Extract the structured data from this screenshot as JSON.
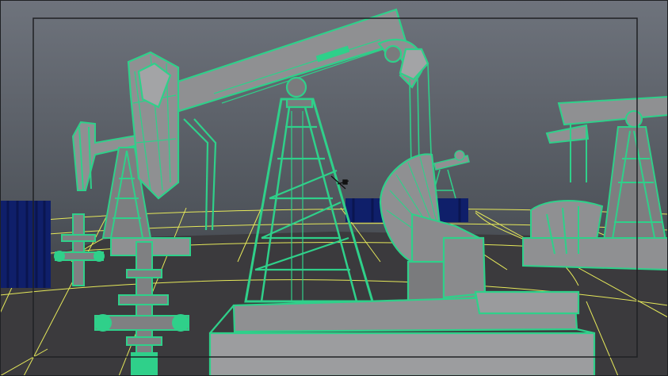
{
  "viewport": {
    "background_top": "#6e737c",
    "background_bottom": "#2e3034",
    "ground_color": "#3b3a3d",
    "grid_color": "#e5e85a",
    "wire_color": "#2fd08a",
    "mesh_color": "#8f9092",
    "frame_color": "#1f2124",
    "tank_color": "#0f1f6a",
    "manipulator_color": "#111111"
  },
  "scene": {
    "objects": [
      "pumpjack-main",
      "pumpjack-left",
      "pumpjack-right",
      "pumpjack-distant",
      "wellhead-valve-front",
      "wellhead-valve-back",
      "storage-tank-left",
      "storage-tank-center"
    ]
  }
}
